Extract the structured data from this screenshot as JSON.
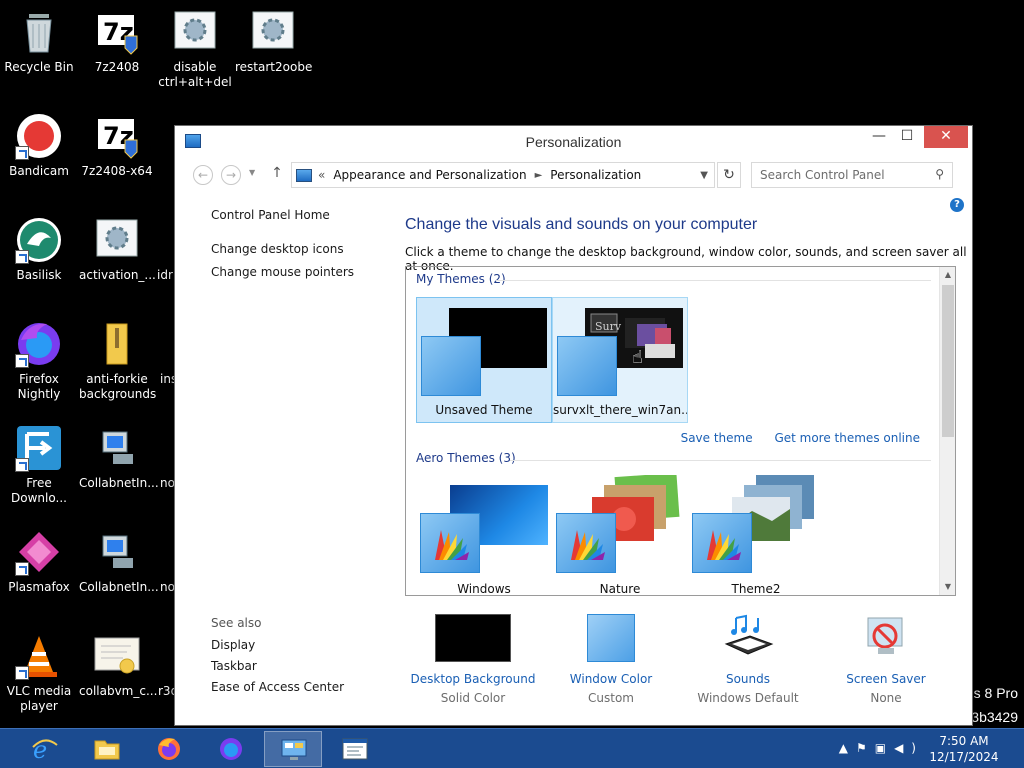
{
  "desktop": {
    "icons": [
      {
        "label": "Recycle Bin"
      },
      {
        "label": "7z2408"
      },
      {
        "label": "disable ctrl+alt+del"
      },
      {
        "label": "restart2oobe"
      },
      {
        "label": "Bandicam"
      },
      {
        "label": "7z2408-x64"
      },
      {
        "label": "Basilisk"
      },
      {
        "label": "activation_..."
      },
      {
        "label": "idr"
      },
      {
        "label": "Firefox Nightly"
      },
      {
        "label": "anti-forkie backgrounds"
      },
      {
        "label": "ins"
      },
      {
        "label": "Free Downlo..."
      },
      {
        "label": "CollabnetIn..."
      },
      {
        "label": "no"
      },
      {
        "label": "Plasmafox"
      },
      {
        "label": "CollabnetIn..."
      },
      {
        "label": "no"
      },
      {
        "label": "VLC media player"
      },
      {
        "label": "collabvm_c..."
      },
      {
        "label": "r3d"
      }
    ],
    "watermark_line1": "s 8 Pro",
    "watermark_line2": "3b3429"
  },
  "window": {
    "title": "Personalization",
    "minimize": "—",
    "maximize": "☐",
    "close": "✕",
    "nav": {
      "back": "←",
      "forward": "→",
      "up": "↑"
    },
    "breadcrumb": {
      "prefix": "«",
      "items": [
        "Appearance and Personalization",
        "Personalization"
      ],
      "separator": "►"
    },
    "search_placeholder": "Search Control Panel",
    "left_nav": {
      "home": "Control Panel Home",
      "links": [
        "Change desktop icons",
        "Change mouse pointers"
      ]
    },
    "heading": "Change the visuals and sounds on your computer",
    "subheading": "Click a theme to change the desktop background, window color, sounds, and screen saver all at once.",
    "my_themes": {
      "title": "My Themes (2)",
      "items": [
        {
          "name": "Unsaved Theme"
        },
        {
          "name": "survxlt_there_win7an..."
        }
      ],
      "save_theme": "Save theme",
      "get_more": "Get more themes online"
    },
    "aero_themes": {
      "title": "Aero Themes (3)",
      "items": [
        {
          "name": "Windows"
        },
        {
          "name": "Nature"
        },
        {
          "name": "Theme2"
        }
      ]
    },
    "see_also": {
      "title": "See also",
      "links": [
        "Display",
        "Taskbar",
        "Ease of Access Center"
      ]
    },
    "bottom": [
      {
        "link": "Desktop Background",
        "sub": "Solid Color",
        "icon": "desktop-background-icon"
      },
      {
        "link": "Window Color",
        "sub": "Custom",
        "icon": "window-color-icon"
      },
      {
        "link": "Sounds",
        "sub": "Windows Default",
        "icon": "sounds-icon"
      },
      {
        "link": "Screen Saver",
        "sub": "None",
        "icon": "screen-saver-icon"
      }
    ]
  },
  "taskbar": {
    "buttons": [
      "internet-explorer",
      "file-explorer",
      "firefox",
      "firefox-nightly",
      "control-panel",
      "document"
    ],
    "time": "7:50 AM",
    "date": "12/17/2024"
  },
  "colors": {
    "link": "#1a5fb4",
    "heading": "#1e3a8a",
    "taskbar": "#1b4b90",
    "selection": "#cfe8fa"
  }
}
